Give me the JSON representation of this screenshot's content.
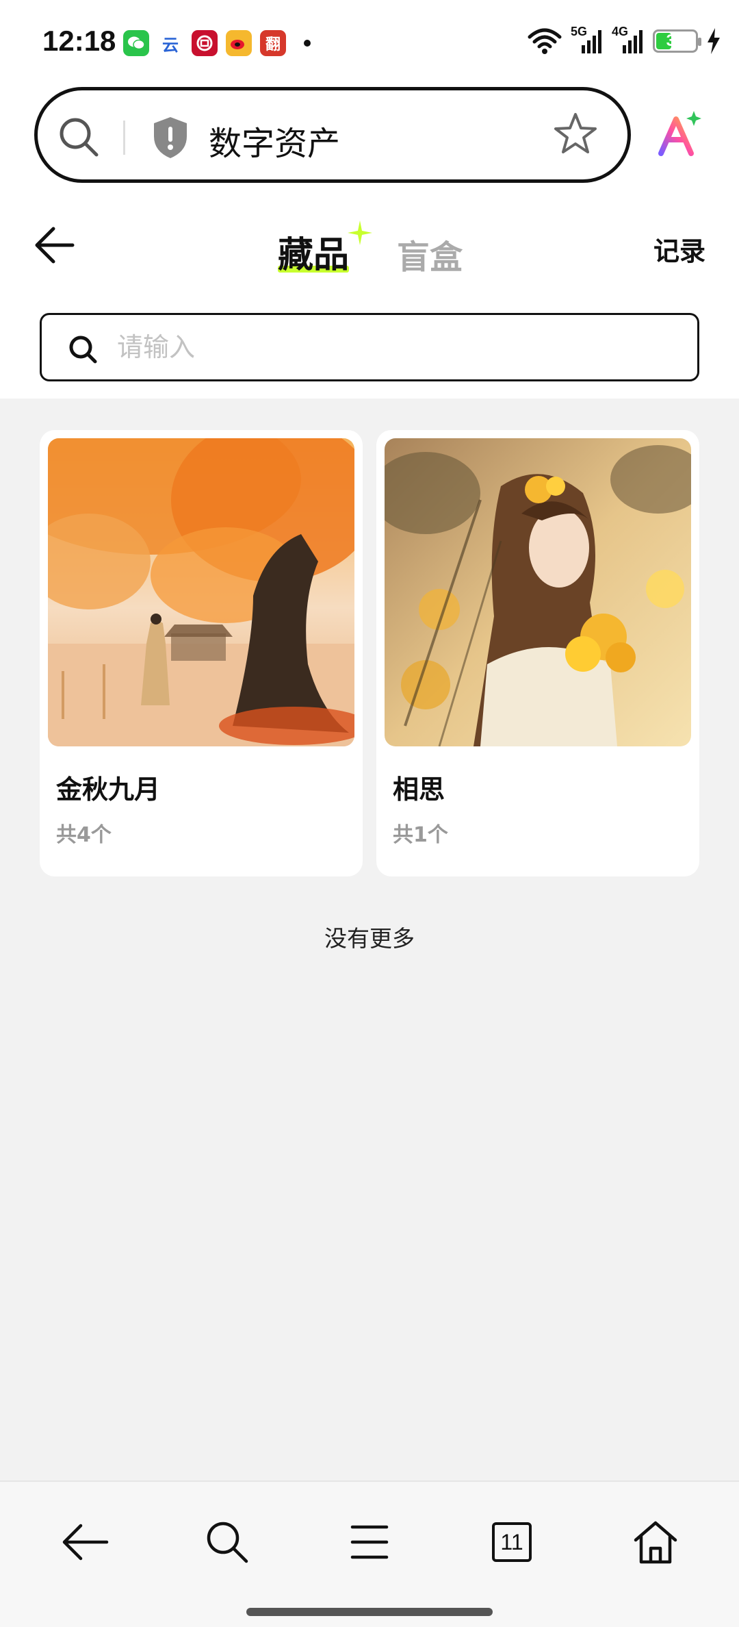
{
  "status_bar": {
    "time": "12:18",
    "app_icons": [
      {
        "name": "wechat-app-icon",
        "color": "#2ac44b",
        "glyph": "✉"
      },
      {
        "name": "cloud-app-icon",
        "color": "#ffffff",
        "glyph": "云"
      },
      {
        "name": "bank-app-icon",
        "color": "#c8102e",
        "glyph": "⊕"
      },
      {
        "name": "weibo-app-icon",
        "color": "#f5b82e",
        "glyph": "◉"
      },
      {
        "name": "news-app-icon",
        "color": "#d6382b",
        "glyph": "翻"
      }
    ],
    "signal_1": "5G",
    "signal_2": "4G",
    "battery_level": 37,
    "battery_text": "37"
  },
  "browser": {
    "address_text": "数字资产"
  },
  "header": {
    "tabs": [
      {
        "label": "藏品",
        "active": true
      },
      {
        "label": "盲盒",
        "active": false
      }
    ],
    "record_label": "记录",
    "accent_color": "#c8ff2e"
  },
  "search": {
    "placeholder": "请输入"
  },
  "collections": [
    {
      "title": "金秋九月",
      "count": "共4个",
      "image": "autumn-tree-illustration"
    },
    {
      "title": "相思",
      "count": "共1个",
      "image": "girl-with-yellow-flowers-illustration"
    }
  ],
  "footer_text": "没有更多",
  "bottom_nav": {
    "tab_count": "11"
  }
}
